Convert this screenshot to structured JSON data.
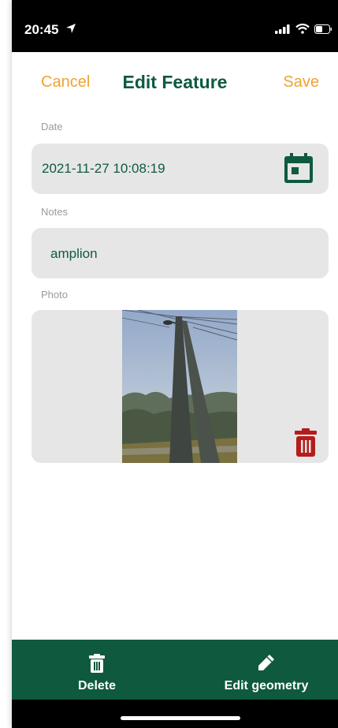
{
  "status_bar": {
    "time": "20:45"
  },
  "header": {
    "cancel_label": "Cancel",
    "title": "Edit Feature",
    "save_label": "Save"
  },
  "form": {
    "date_label": "Date",
    "date_value": "2021-11-27 10:08:19",
    "notes_label": "Notes",
    "notes_value": "amplion",
    "photo_label": "Photo"
  },
  "bottom_bar": {
    "delete_label": "Delete",
    "edit_geometry_label": "Edit geometry"
  },
  "colors": {
    "primary": "#0f5a3e",
    "accent": "#f0a332",
    "danger": "#b51c1c",
    "field_bg": "#e6e6e6"
  },
  "icons": [
    "location-arrow-icon",
    "signal-icon",
    "wifi-icon",
    "battery-icon",
    "calendar-icon",
    "trash-icon",
    "pencil-icon"
  ]
}
